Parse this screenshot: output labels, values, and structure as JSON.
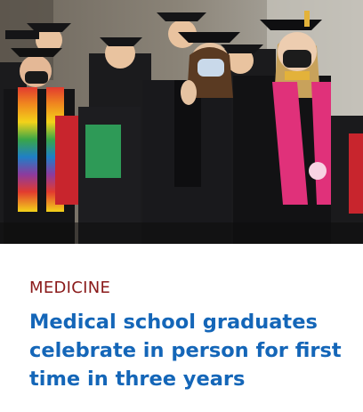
{
  "card": {
    "category": "MEDICINE",
    "headline": "Medical school graduates celebrate in person for first time in three years"
  },
  "photo": {
    "subject": "graduates-in-caps-and-gowns"
  },
  "colors": {
    "category": "#8a1a1a",
    "headline": "#1466b8",
    "background": "#ffffff"
  }
}
